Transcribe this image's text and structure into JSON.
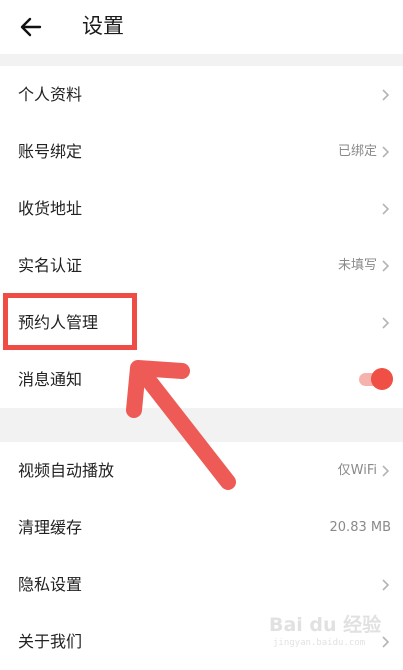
{
  "header": {
    "title": "设置",
    "back_icon": "arrow-left-icon"
  },
  "section1": {
    "items": [
      {
        "label": "个人资料",
        "value": ""
      },
      {
        "label": "账号绑定",
        "value": "已绑定"
      },
      {
        "label": "收货地址",
        "value": ""
      },
      {
        "label": "实名认证",
        "value": "未填写"
      },
      {
        "label": "预约人管理",
        "value": ""
      },
      {
        "label": "消息通知",
        "toggle": true
      }
    ]
  },
  "section2": {
    "items": [
      {
        "label": "视频自动播放",
        "value": "仅WiFi"
      },
      {
        "label": "清理缓存",
        "value": "20.83 MB"
      },
      {
        "label": "隐私设置",
        "value": ""
      },
      {
        "label": "关于我们",
        "value": ""
      }
    ]
  },
  "annotation": {
    "highlight_color": "#ee4c45",
    "arrow_color": "#ee5a55"
  },
  "watermark": {
    "brand": "Bai du 经验",
    "url": "jingyan.baidu.com"
  },
  "colors": {
    "toggle_on": "#ef4f45",
    "toggle_track": "#f6b3ad",
    "section_gap": "#f2f2f2"
  }
}
